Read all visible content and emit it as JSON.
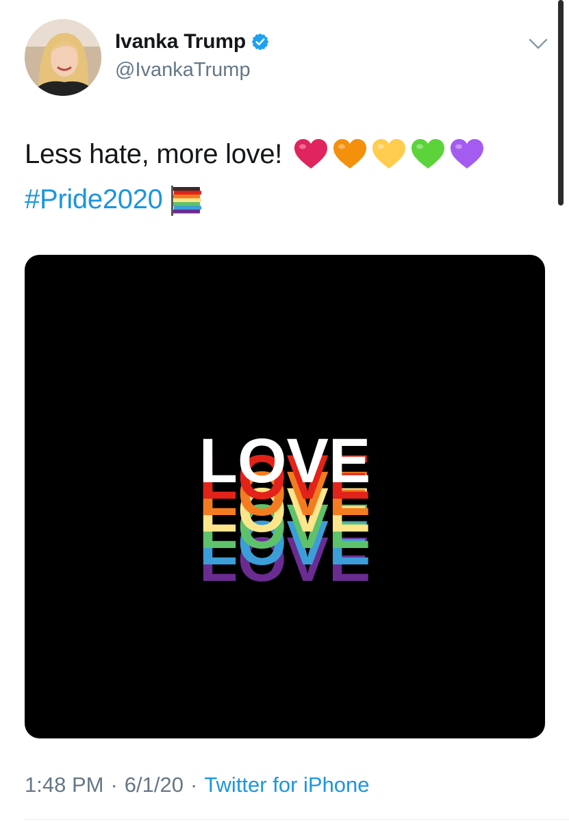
{
  "author": {
    "display_name": "Ivanka Trump",
    "handle": "@IvankaTrump",
    "verified": true
  },
  "tweet": {
    "text_line1": "Less hate, more love!",
    "hearts": [
      {
        "name": "red-heart-icon",
        "color": "#e0245e"
      },
      {
        "name": "orange-heart-icon",
        "color": "#f4900c"
      },
      {
        "name": "yellow-heart-icon",
        "color": "#ffcc4d"
      },
      {
        "name": "green-heart-icon",
        "color": "#5cd33a"
      },
      {
        "name": "purple-heart-icon",
        "color": "#a45bf0"
      }
    ],
    "hashtag": "#Pride2020",
    "media_text": "LOVE"
  },
  "meta": {
    "time": "1:48 PM",
    "separator": "·",
    "date": "6/1/20",
    "source": "Twitter for iPhone"
  },
  "colors": {
    "link": "#1b95e0",
    "secondary_text": "#657786",
    "rainbow": [
      "#e2231a",
      "#f47c20",
      "#fde58b",
      "#5ec26a",
      "#3b9ed8",
      "#6a2c91"
    ]
  }
}
